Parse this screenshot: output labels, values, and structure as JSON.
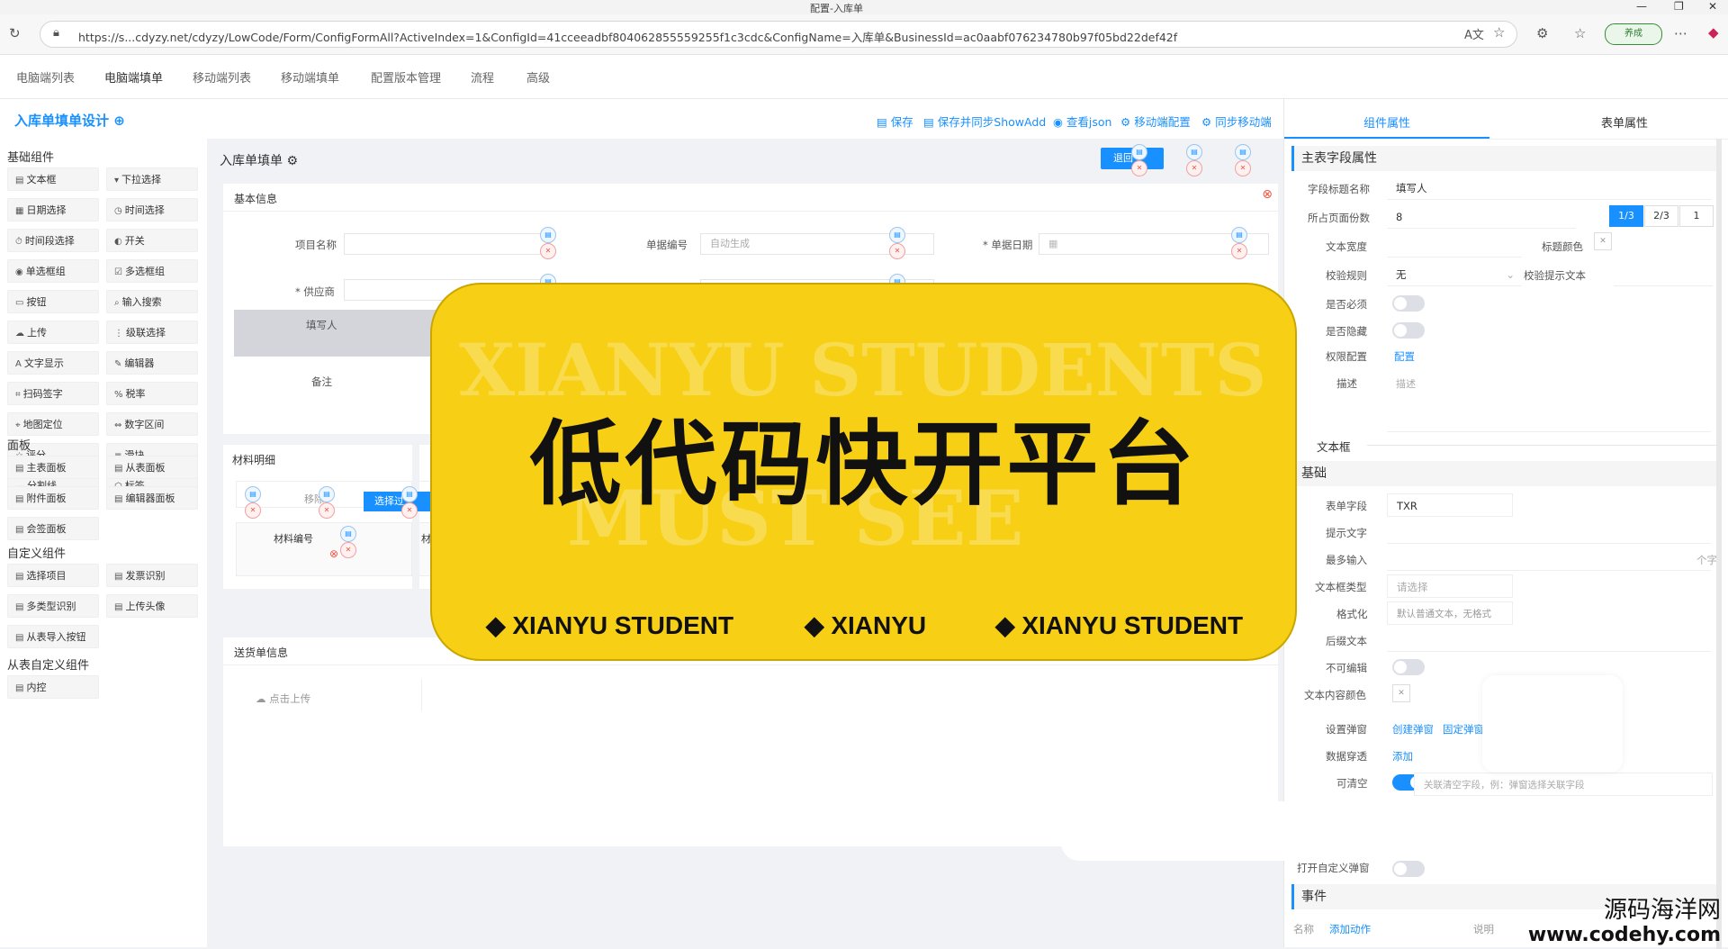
{
  "browser": {
    "tab_title": "配置-入库单",
    "url": "https://s...cdyzy.net/cdyzy/LowCode/Form/ConfigFormAll?ActiveIndex=1&ConfigId=41cceeadbf804062855559255f1c3cdc&ConfigName=入库单&BusinessId=ac0aabf076234780b97f05bd22def42f",
    "pill_label": "养成"
  },
  "top_tabs": [
    "电脑端列表",
    "电脑端填单",
    "移动端列表",
    "移动端填单",
    "配置版本管理",
    "流程",
    "高级"
  ],
  "header": {
    "title": "入库单填单设计",
    "actions": [
      "保存",
      "保存并同步ShowAdd",
      "查看json",
      "移动端配置",
      "同步移动端"
    ]
  },
  "palette": {
    "sections": [
      {
        "title": "基础组件",
        "items": [
          "文本框",
          "下拉选择",
          "日期选择",
          "时间选择",
          "时间段选择",
          "开关",
          "单选框组",
          "多选框组",
          "按钮",
          "输入搜索",
          "上传",
          "级联选择",
          "文字显示",
          "编辑器",
          "扫码签字",
          "税率",
          "地图定位",
          "数字区间",
          "评分",
          "滑块",
          "分割线",
          "标签"
        ]
      },
      {
        "title": "面板",
        "items": [
          "主表面板",
          "从表面板",
          "附件面板",
          "编辑器面板",
          "会签面板"
        ]
      },
      {
        "title": "自定义组件",
        "items": [
          "选择项目",
          "发票识别",
          "多类型识别",
          "上传头像",
          "从表导入按钮"
        ]
      },
      {
        "title": "从表自定义组件",
        "items": [
          "内控"
        ]
      }
    ]
  },
  "canvas": {
    "form_title": "入库单填单",
    "top_button": "退回",
    "basic_info": {
      "title": "基本信息",
      "fields": [
        {
          "label": "项目名称",
          "value": ""
        },
        {
          "label": "单据编号",
          "placeholder": "自动生成"
        },
        {
          "label": "* 单据日期",
          "value": ""
        },
        {
          "label": "* 供应商",
          "value": ""
        },
        {
          "label": "填写人",
          "value": ""
        },
        {
          "label": "备注",
          "value": ""
        }
      ]
    },
    "materials": {
      "title": "材料明细",
      "buttons": [
        "移除",
        "选择过"
      ],
      "col_first": "材料编号",
      "col_second": "材"
    },
    "delivery": {
      "title": "送货单信息",
      "upload_label": "点击上传"
    }
  },
  "right_panel": {
    "tabs": [
      "组件属性",
      "表单属性"
    ],
    "main_section": "主表字段属性",
    "field_title_label": "字段标题名称",
    "field_title_value": "填写人",
    "page_share_label": "所占页面份数",
    "page_share_value": "8",
    "page_share_options": [
      "1/3",
      "2/3",
      "1"
    ],
    "text_width_label": "文本宽度",
    "title_color_label": "标题颜色",
    "validate_rule_label": "校验规则",
    "validate_rule_value": "无",
    "validate_tip_label": "校验提示文本",
    "required_label": "是否必须",
    "hidden_label": "是否隐藏",
    "perm_label": "权限配置",
    "perm_link": "配置",
    "desc_label": "描述",
    "desc_placeholder": "描述",
    "text_box_label": "文本框",
    "basic_section": "基础",
    "form_field_label": "表单字段",
    "form_field_value": "TXR",
    "hint_text_label": "提示文字",
    "max_input_label": "最多输入",
    "max_input_unit": "个字",
    "textbox_type_label": "文本框类型",
    "textbox_type_value": "请选择",
    "format_label": "格式化",
    "format_value": "默认普通文本，无格式",
    "suffix_label": "后缀文本",
    "readonly_label": "不可编辑",
    "content_color_label": "文本内容颜色",
    "popup_label": "设置弹窗",
    "popup_links": [
      "创建弹窗",
      "固定弹窗"
    ],
    "penetrate_label": "数据穿透",
    "penetrate_link": "添加",
    "clearable_label": "可清空",
    "clearable_placeholder": "关联清空字段，例：弹窗选择关联字段",
    "custom_popup_label": "打开自定义弹窗",
    "events_section": "事件",
    "events_sub_label": "名称",
    "events_sub_link": "添加动作",
    "events_sub_col": "说明"
  },
  "banner": {
    "ghost_top": "XIANYU STUDENTS",
    "ghost_bottom": "MUST SEE",
    "headline": "低代码快开平台",
    "tags": [
      "XIANYU STUDENT",
      "XIANYU",
      "XIANYU STUDENT"
    ]
  },
  "watermark": {
    "line1": "源码海洋网",
    "line2": "www.codehy.com"
  }
}
